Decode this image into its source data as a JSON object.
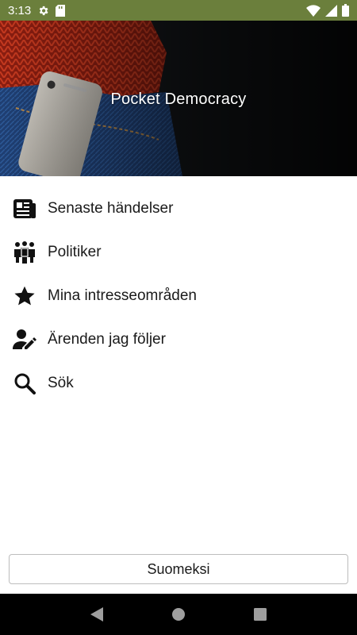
{
  "status_bar": {
    "time": "3:13",
    "left_icons": [
      "gear-icon",
      "sd-card-icon"
    ],
    "right_icons": [
      "wifi-icon",
      "signal-icon",
      "battery-icon"
    ],
    "background": "#6b7f3c"
  },
  "header": {
    "title": "Pocket Democracy"
  },
  "menu": {
    "items": [
      {
        "label": "Senaste händelser",
        "icon": "newspaper-icon"
      },
      {
        "label": "Politiker",
        "icon": "people-icon"
      },
      {
        "label": "Mina intresseområden",
        "icon": "star-icon"
      },
      {
        "label": "Ärenden jag följer",
        "icon": "person-edit-icon"
      },
      {
        "label": "Sök",
        "icon": "search-icon"
      }
    ]
  },
  "language_button": {
    "label": "Suomeksi"
  },
  "nav_bar": {
    "buttons": [
      "back-icon",
      "home-icon",
      "recents-icon"
    ]
  }
}
